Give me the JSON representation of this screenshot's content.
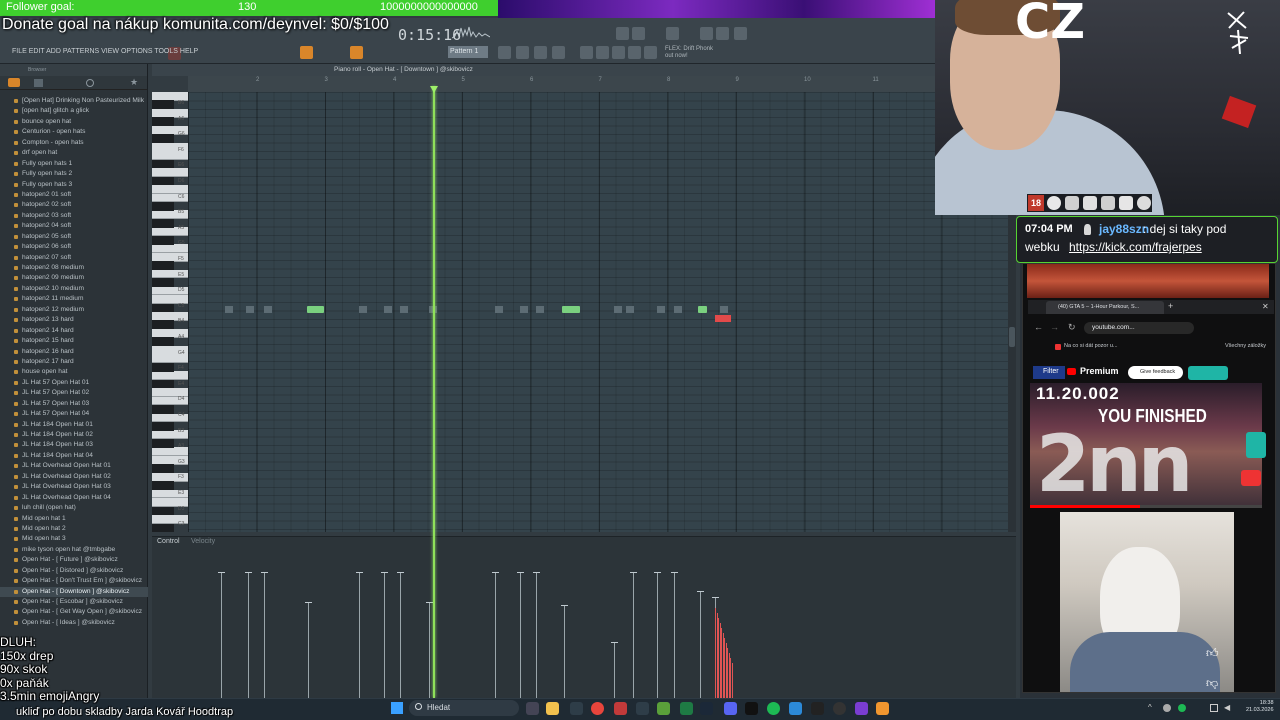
{
  "overlay": {
    "follower_goal_label": "Follower goal:",
    "follower_count": "130",
    "follower_target": "1000000000000000",
    "donate_text": "Donate goal na nákup komunita.com/deynvel: $0/$100",
    "streamer_tag": "CZ",
    "debt_lines": [
      "DLUH:",
      "150x drep",
      "90x skok",
      "0x paňák",
      "3.5min emojiAngry"
    ],
    "now_playing": "ukliď po dobu skladby Jarda Kovář Hoodtrap",
    "colors": {
      "goal_bar": "#3fcf2e",
      "chat_border": "#56d432"
    }
  },
  "fl_studio": {
    "time": "0:15:16",
    "menu": [
      "FILE",
      "EDIT",
      "ADD",
      "PATTERNS",
      "VIEW",
      "OPTIONS",
      "TOOLS",
      "HELP"
    ],
    "pattern": "Pattern 1",
    "plugin_hint": "FLEX: Drift Phonk",
    "plugin_hint2": "out now!",
    "browser_title": "Browser",
    "piano_roll_title": "Piano roll - Open Hat - [ Downtown ] @skibovicz",
    "ruler_marks": [
      "2",
      "3",
      "4",
      "5",
      "6",
      "7",
      "8",
      "9",
      "10",
      "11"
    ],
    "control_label": "Control",
    "velocity_label": "Velocity",
    "browser_items": [
      "[Open Hat] Drinking Non Pasteurized Milk",
      "[open hat] glitch a glick",
      "bounce open hat",
      "Centurion - open hats",
      "Compton - open hats",
      "drf open hat",
      "Fully open hats 1",
      "Fully open hats 2",
      "Fully open hats 3",
      "hatopen2 01 soft",
      "hatopen2 02 soft",
      "hatopen2 03 soft",
      "hatopen2 04 soft",
      "hatopen2 05 soft",
      "hatopen2 06 soft",
      "hatopen2 07 soft",
      "hatopen2 08 medium",
      "hatopen2 09 medium",
      "hatopen2 10 medium",
      "hatopen2 11 medium",
      "hatopen2 12 medium",
      "hatopen2 13 hard",
      "hatopen2 14 hard",
      "hatopen2 15 hard",
      "hatopen2 16 hard",
      "hatopen2 17 hard",
      "house open hat",
      "JL Hat 57 Open Hat 01",
      "JL Hat 57 Open Hat 02",
      "JL Hat 57 Open Hat 03",
      "JL Hat 57 Open Hat 04",
      "JL Hat 184 Open Hat 01",
      "JL Hat 184 Open Hat 02",
      "JL Hat 184 Open Hat 03",
      "JL Hat 184 Open Hat 04",
      "JL Hat Overhead Open Hat 01",
      "JL Hat Overhead Open Hat 02",
      "JL Hat Overhead Open Hat 03",
      "JL Hat Overhead Open Hat 04",
      "luh chill (open hat)",
      "Mid open hat 1",
      "Mid open hat 2",
      "Mid open hat 3",
      "mike tyson open hat @tmbgabe",
      "Open Hat - [ Future ] @skibovicz",
      "Open Hat - [ Distored ] @skibovicz",
      "Open Hat - [ Don't Trust Em ] @skibovicz",
      "Open Hat - [ Downtown ] @skibovicz",
      "Open Hat - [ Escobar ] @skibovicz",
      "Open Hat - [ Get Way Open ] @skibovicz",
      "Open Hat - [ Ideas ] @skibovicz"
    ],
    "selected_index": 47,
    "key_labels": [
      "B6",
      "A6",
      "G6",
      "F6",
      "E6",
      "D6",
      "C6",
      "B5",
      "A5",
      "G5",
      "F5",
      "E5",
      "D5",
      "C5",
      "B4",
      "A4",
      "G4",
      "F4",
      "E4",
      "D4",
      "C4",
      "B3",
      "A3",
      "G3",
      "F3",
      "E3",
      "D3",
      "C3"
    ]
  },
  "chat": {
    "time": "07:04 PM",
    "user": "jay88szn",
    "message": ": dej si taky pod",
    "message_line2": "webku",
    "link": "https://kick.com/frajerpes"
  },
  "web": {
    "tab_title": "(40) GTA 5 – 1-Hour Parkour, S...",
    "address": "youtube.com...",
    "bookmark": "Na co si dát pozor u...",
    "bookmarks_all": "Všechny záložky",
    "filter_label": "Filter",
    "premium_label": "Premium",
    "feedback_label": "Give feedback",
    "video_date": "11.20.002",
    "video_finished": "YOU FINISHED",
    "video_big": "2nn"
  },
  "taskbar": {
    "search_placeholder": "Hledat",
    "clock_time": "18:38",
    "clock_date": "21.03.2026"
  }
}
